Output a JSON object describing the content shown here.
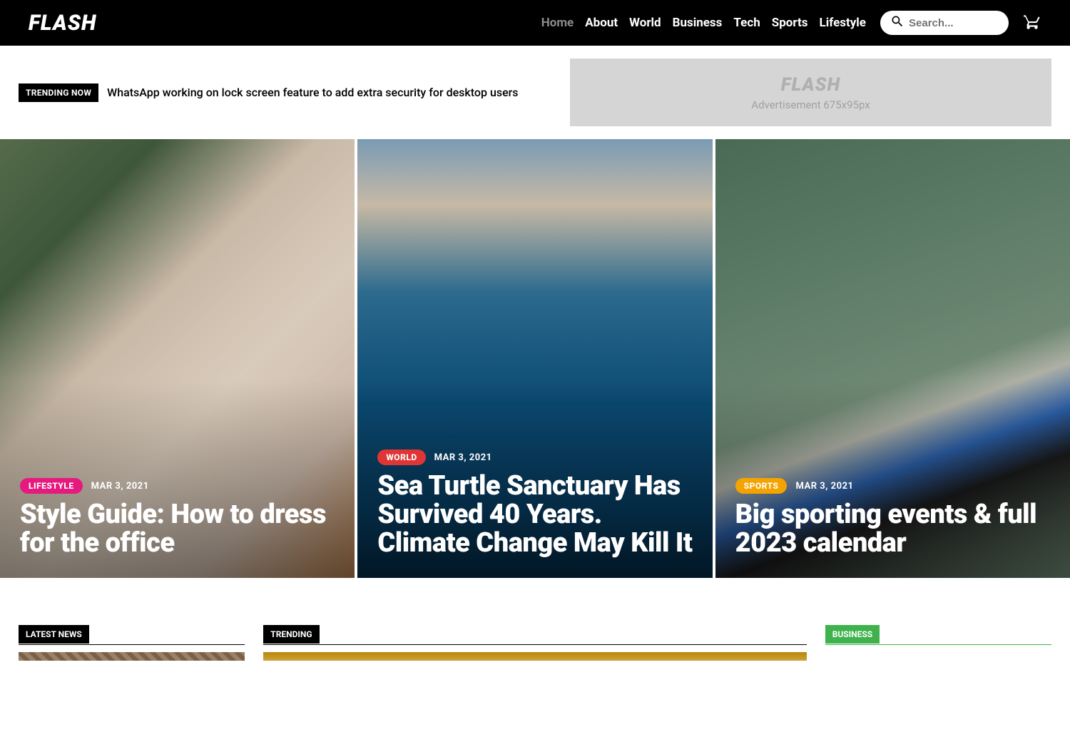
{
  "brand": "FLASH",
  "nav": {
    "items": [
      "Home",
      "About",
      "World",
      "Business",
      "Tech",
      "Sports",
      "Lifestyle"
    ],
    "active_index": 0
  },
  "search": {
    "placeholder": "Search..."
  },
  "ticker": {
    "label": "TRENDING NOW",
    "headline": "WhatsApp working on lock screen feature to add extra security for desktop users"
  },
  "advertisement": {
    "logo": "FLASH",
    "size_label": "Advertisement 675x95px"
  },
  "hero": [
    {
      "category": "LIFESTYLE",
      "category_class": "cat-lifestyle",
      "date": "MAR 3, 2021",
      "title": "Style Guide: How to dress for the office"
    },
    {
      "category": "WORLD",
      "category_class": "cat-world",
      "date": "MAR 3, 2021",
      "title": "Sea Turtle Sanctuary Has Survived 40 Years. Climate Change May Kill It"
    },
    {
      "category": "SPORTS",
      "category_class": "cat-sports",
      "date": "MAR 3, 2021",
      "title": "Big sporting events & full 2023 calendar"
    }
  ],
  "sections": {
    "latest_news": "LATEST NEWS",
    "trending": "TRENDING",
    "business": "BUSINESS"
  },
  "colors": {
    "lifestyle": "#e6197e",
    "world": "#e03535",
    "sports": "#f4a300",
    "business": "#3fb24d"
  }
}
